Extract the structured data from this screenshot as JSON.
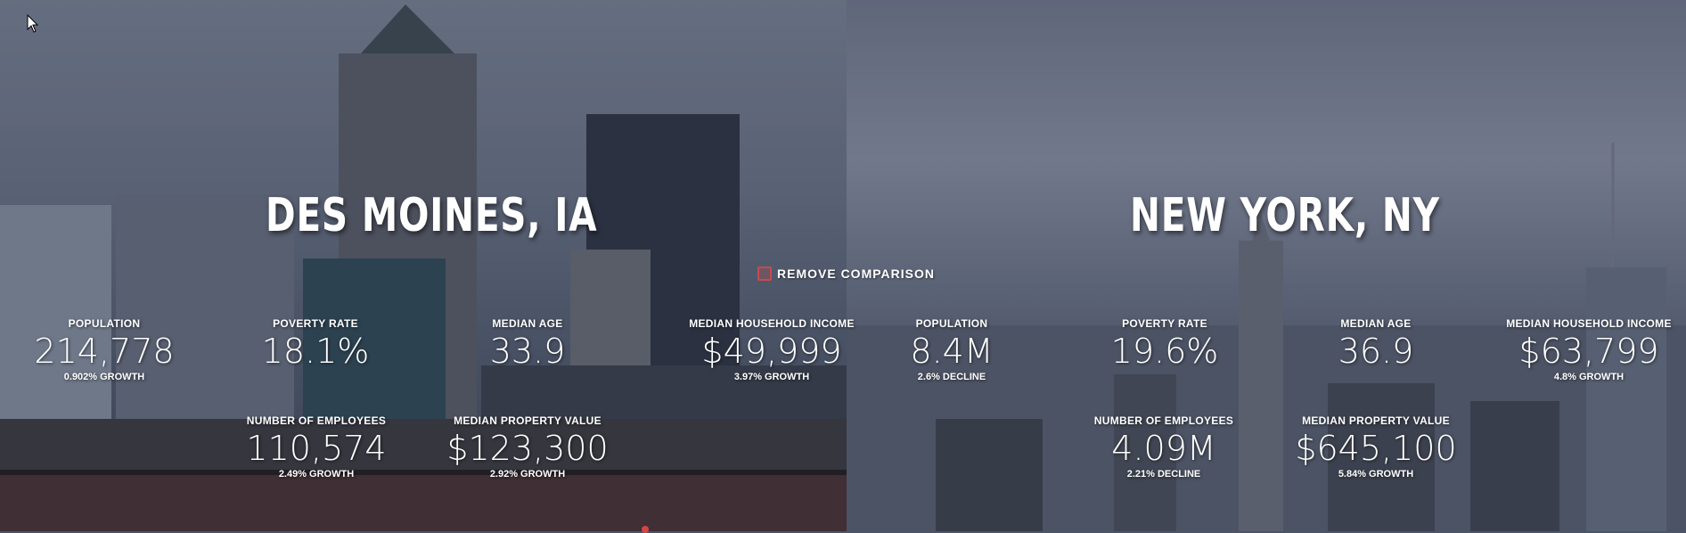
{
  "remove_comparison_label": "REMOVE COMPARISON",
  "accent_color": "#c94a4a",
  "cities": [
    {
      "name": "DES MOINES, IA",
      "stats": [
        {
          "label": "POPULATION",
          "value": "214,778",
          "change": "0.902% GROWTH"
        },
        {
          "label": "POVERTY RATE",
          "value": "18.1%",
          "change": ""
        },
        {
          "label": "MEDIAN AGE",
          "value": "33.9",
          "change": ""
        },
        {
          "label": "MEDIAN HOUSEHOLD INCOME",
          "value": "$49,999",
          "change": "3.97% GROWTH"
        },
        {
          "label": "NUMBER OF EMPLOYEES",
          "value": "110,574",
          "change": "2.49% GROWTH"
        },
        {
          "label": "MEDIAN PROPERTY VALUE",
          "value": "$123,300",
          "change": "2.92% GROWTH"
        }
      ]
    },
    {
      "name": "NEW YORK, NY",
      "stats": [
        {
          "label": "POPULATION",
          "value": "8.4M",
          "change": "2.6% DECLINE"
        },
        {
          "label": "POVERTY RATE",
          "value": "19.6%",
          "change": ""
        },
        {
          "label": "MEDIAN AGE",
          "value": "36.9",
          "change": ""
        },
        {
          "label": "MEDIAN HOUSEHOLD INCOME",
          "value": "$63,799",
          "change": "4.8% GROWTH"
        },
        {
          "label": "NUMBER OF EMPLOYEES",
          "value": "4.09M",
          "change": "2.21% DECLINE"
        },
        {
          "label": "MEDIAN PROPERTY VALUE",
          "value": "$645,100",
          "change": "5.84% GROWTH"
        }
      ]
    }
  ]
}
